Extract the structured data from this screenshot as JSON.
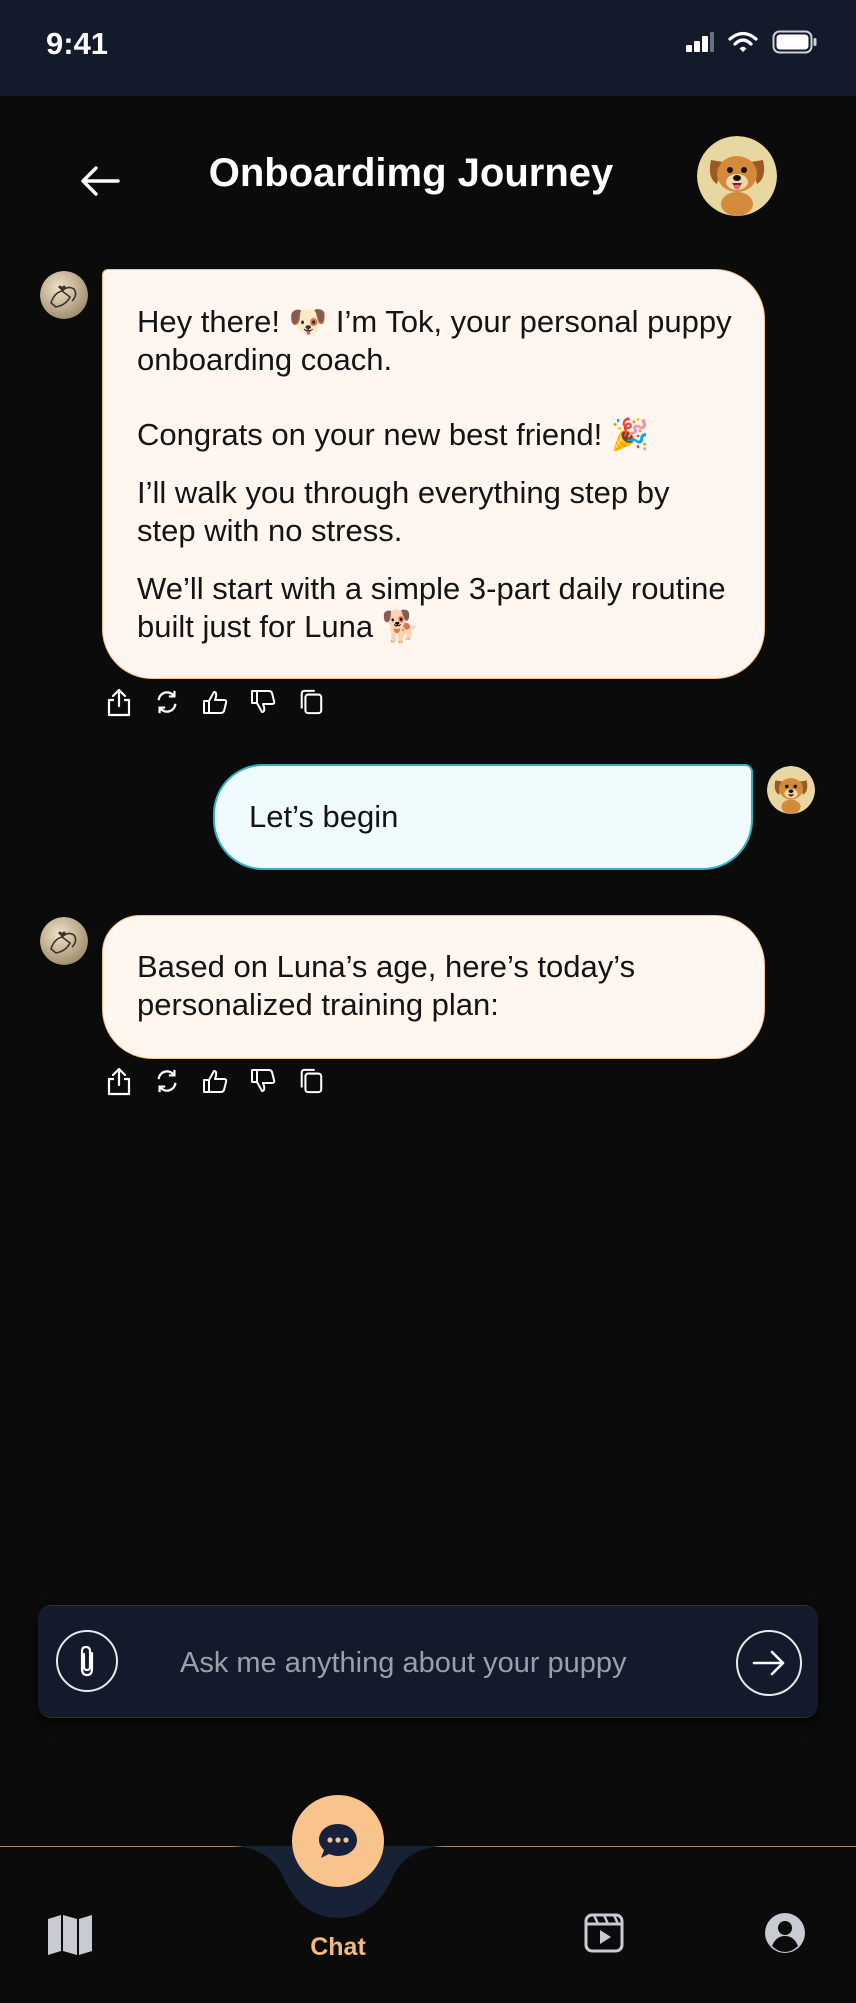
{
  "status_bar": {
    "time": "9:41"
  },
  "header": {
    "title": "Onboardimg Journey"
  },
  "messages": [
    {
      "role": "bot",
      "paragraphs": [
        "Hey there! 🐶 I’m Tok, your personal puppy onboarding coach.",
        " Congrats on your new best friend! 🎉",
        "I’ll walk you through everything step by step with no stress.",
        "We’ll start with a simple 3-part daily routine built just for Luna 🐕"
      ]
    },
    {
      "role": "user",
      "text": "Let’s begin"
    },
    {
      "role": "bot",
      "paragraphs": [
        "Based on Luna’s age, here’s today’s personalized training plan:"
      ]
    }
  ],
  "composer": {
    "placeholder": "Ask me anything about your puppy",
    "value": ""
  },
  "nav": {
    "chat_label": "Chat"
  },
  "colors": {
    "accent": "#f9c38d",
    "accent_text": "#f5b978",
    "bot_bubble": "#fff6ef",
    "bot_border": "#f4c28e",
    "user_bubble": "#f0fbfd",
    "user_border": "#2fb3c0",
    "panel": "#121a2c"
  }
}
